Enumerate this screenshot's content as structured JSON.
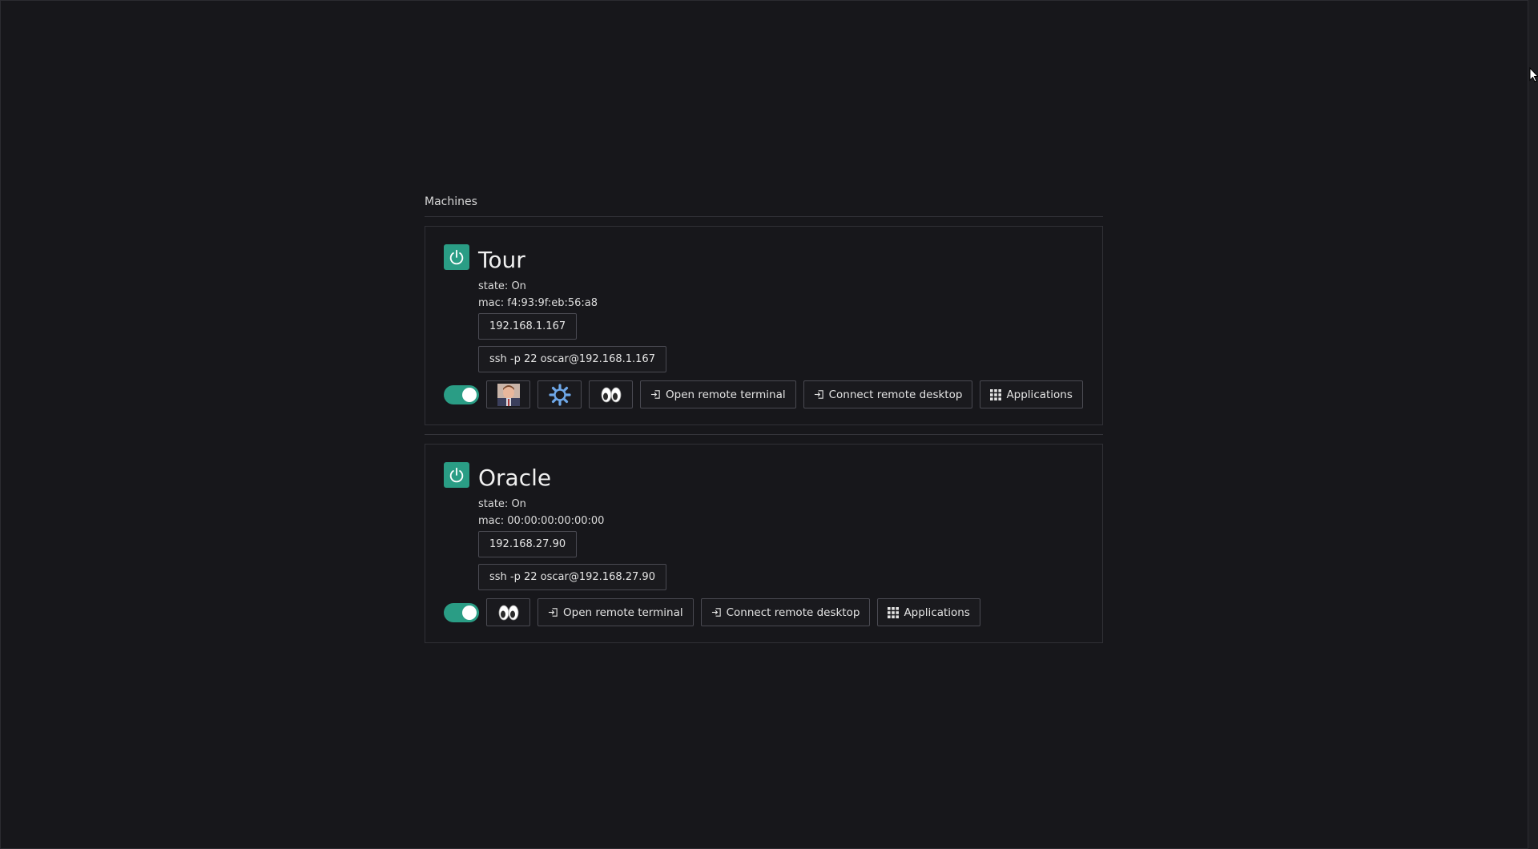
{
  "page": {
    "section_title": "Machines"
  },
  "colors": {
    "accent": "#2a9d85",
    "background": "#17171b",
    "border": "#4a4a52"
  },
  "machines": [
    {
      "name": "Tour",
      "state_line": "state: On",
      "mac_line": "mac: f4:93:9f:eb:56:a8",
      "ip": "192.168.1.167",
      "ssh": "ssh -p 22 oscar@192.168.1.167",
      "toggle_on": true,
      "icon_buttons": [
        "avatar-icon",
        "gear-icon",
        "eyes-icon"
      ],
      "open_terminal_label": "Open remote terminal",
      "connect_desktop_label": "Connect remote desktop",
      "applications_label": "Applications"
    },
    {
      "name": "Oracle",
      "state_line": "state: On",
      "mac_line": "mac: 00:00:00:00:00:00",
      "ip": "192.168.27.90",
      "ssh": "ssh -p 22 oscar@192.168.27.90",
      "toggle_on": true,
      "icon_buttons": [
        "eyes-icon"
      ],
      "open_terminal_label": "Open remote terminal",
      "connect_desktop_label": "Connect remote desktop",
      "applications_label": "Applications"
    }
  ]
}
